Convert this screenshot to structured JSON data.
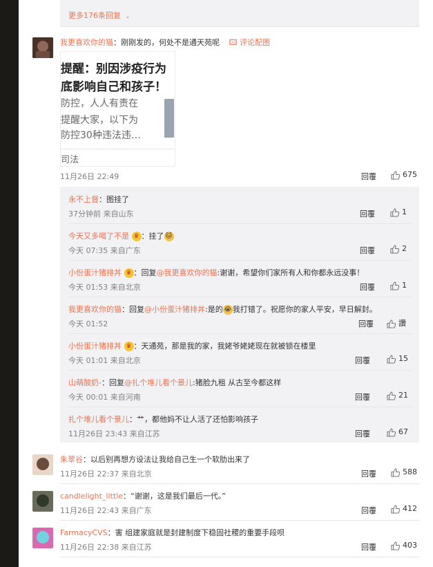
{
  "top": {
    "more_replies": "更多176条回复"
  },
  "main_comment": {
    "name": "我更喜欢你的猫",
    "text": "：刚刚发的，何处不是通天苑呢",
    "pic_label": "评论配图",
    "image": {
      "line1": "提醒：别因涉疫行为",
      "line2": "底影响自己和孩子！",
      "line3": "防控，人人有责在",
      "line4": "提醒大家，以下为",
      "line5": "防控30种违法违…",
      "source": "司法"
    },
    "time": "11月26日 22:49",
    "reply": "回覆",
    "likes": "675"
  },
  "replies": [
    {
      "name": "永不上督",
      "text": "：图挂了",
      "time": "37分钟前 来自山东",
      "reply": "回覆",
      "likes": "1"
    },
    {
      "name": "今天又多喝了不是",
      "text": "：挂了",
      "time": "今天 07:35 来自广东",
      "reply": "回覆",
      "likes": "2"
    },
    {
      "name": "小份蛋汁猪排丼",
      "prefix": "：回复",
      "at": "@我更喜欢你的猫",
      "text": ":谢谢，希望你们家所有人和你都永远没事！",
      "time": "今天 01:53 来自北京",
      "reply": "回覆",
      "likes": "1"
    },
    {
      "name": "我更喜欢你的猫",
      "prefix": "：回复",
      "at": "@小份蛋汁猪排丼",
      "text": ":是的",
      "text2": "我打错了。祝愿你的家人平安，早日解封。",
      "time": "今天 01:52",
      "reply": "回覆",
      "likes": "讚"
    },
    {
      "name": "小份蛋汁猪排丼",
      "text": "：天通苑，那是我的家，我姥爷姥姥现在就被锁在楼里",
      "time": "今天 01:01 来自北京",
      "reply": "回覆",
      "likes": "15"
    },
    {
      "name": "山萌酸奶-",
      "prefix": "：回复",
      "at": "@扎个堆儿看个景儿",
      "text": ":猪脸九租 从古至今都这样",
      "time": "今天 00:01 来自河南",
      "reply": "回覆",
      "likes": "21"
    },
    {
      "name": "扎个堆儿看个景儿",
      "text": "：艹，都他妈不让人活了还怕影响孩子",
      "time": "11月26日 23:43 来自江苏",
      "reply": "回覆",
      "likes": "67"
    }
  ],
  "comments": [
    {
      "name": "朱翠谷",
      "text": "：以后别再想方设法让我给自己生一个软肋出来了",
      "time": "11月26日 22:37 来自北京",
      "reply": "回覆",
      "likes": "588"
    },
    {
      "name": "candlelight_little",
      "text": "：“谢谢，这是我们最后一代。”",
      "time": "11月26日 22:43 来自广东",
      "reply": "回覆",
      "likes": "412"
    },
    {
      "name": "FarmacyCVS",
      "text": "：害 组建家庭就是封建制度下稳固社稷的重要手段呗",
      "time": "11月26日 22:38 来自江苏",
      "reply": "回覆",
      "likes": "403"
    }
  ],
  "colors": {
    "accent": "#eb7350",
    "link": "#eb7350",
    "meta": "#808080",
    "reply_bg": "#f2f2f5"
  }
}
